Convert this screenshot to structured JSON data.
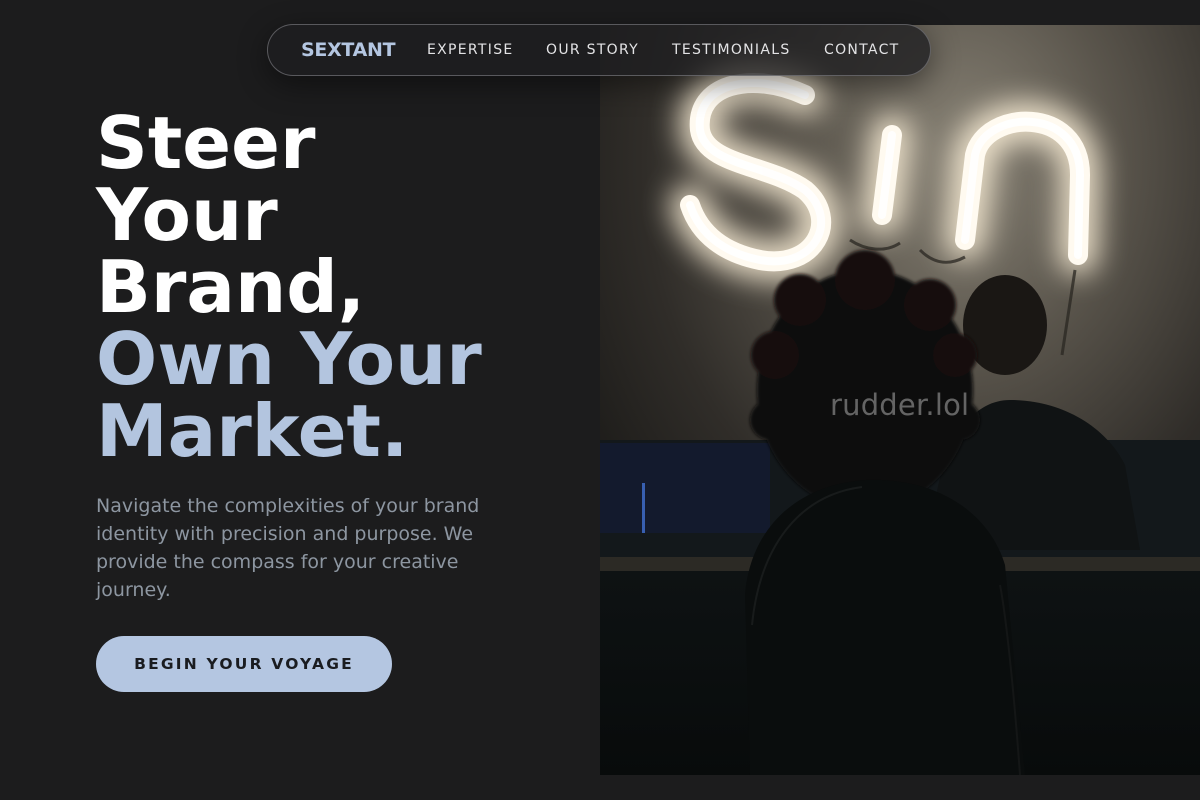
{
  "nav": {
    "logo": "SEXTANT",
    "links": [
      "EXPERTISE",
      "OUR STORY",
      "TESTIMONIALS",
      "CONTACT"
    ]
  },
  "hero": {
    "headline_lines_white": [
      "Steer",
      "Your",
      "Brand,"
    ],
    "headline_lines_accent": [
      "Own Your",
      "Market."
    ],
    "body": "Navigate the complexities of your brand identity with precision and purpose. We provide the compass for your creative journey.",
    "cta_label": "BEGIN YOUR VOYAGE"
  },
  "image": {
    "neon_text": "Sin",
    "watermark": "rudder.lol"
  },
  "colors": {
    "background": "#1c1c1d",
    "accent": "#b4c6e1",
    "body_text": "#8d96a1",
    "nav_text": "#e3e3e5"
  }
}
